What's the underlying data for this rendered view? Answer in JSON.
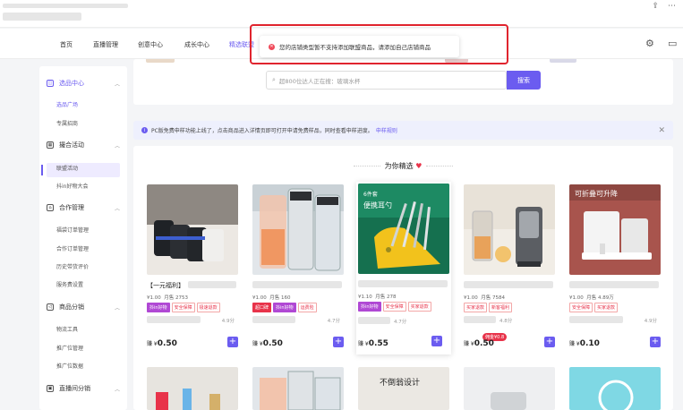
{
  "nav": {
    "items": [
      "首页",
      "直播管理",
      "创意中心",
      "成长中心",
      "精选联盟"
    ],
    "active_index": 4
  },
  "toast": {
    "message": "您的店铺类型暂不支持添加联盟商品，请添加自己店铺商品"
  },
  "sidebar": {
    "groups": [
      {
        "label": "选品中心",
        "icon": "shopping-bag-icon",
        "items": [
          "选品广场",
          "专属招商"
        ]
      },
      {
        "label": "撮合活动",
        "icon": "calendar-icon",
        "items": [
          "联盟活动",
          "抖in好物大会"
        ]
      },
      {
        "label": "合作管理",
        "icon": "handshake-icon",
        "items": [
          "福袋订单管理",
          "合作订单管理",
          "历史带货评价",
          "服务费设置"
        ]
      },
      {
        "label": "商品分销",
        "icon": "share-icon",
        "items": [
          "物流工具",
          "推广位管理",
          "推广位数据"
        ]
      },
      {
        "label": "直播间分销",
        "icon": "live-icon",
        "items": []
      }
    ],
    "active_item": "选品广场"
  },
  "search": {
    "placeholder": "超800位达人正在搜：玻璃水杯",
    "button_label": "搜索"
  },
  "notice": {
    "text": "PC版免费申样功能上线了，点击商品进入详情页即可打开申请免费样品，同时查看申样进度。",
    "link": "申样规则"
  },
  "section": {
    "title": "为你精选"
  },
  "products": [
    {
      "title": "【一元福利】",
      "price": "¥1.00",
      "sold": "月售 2753",
      "tags": [
        "抖in好物",
        "安全保障",
        "极速退款"
      ],
      "rating": "4.9分",
      "earn_prefix": "赚 ¥",
      "earn": "0.50",
      "badge": ""
    },
    {
      "title": "",
      "price": "¥1.00",
      "sold": "月售 160",
      "tags": [
        "超口碑",
        "抖in好物",
        "运费险"
      ],
      "rating": "4.7分",
      "earn_prefix": "赚 ¥",
      "earn": "0.50",
      "badge": ""
    },
    {
      "title": "",
      "price": "¥1.10",
      "sold": "月售 278",
      "tags": [
        "抖in好物",
        "安全保障",
        "买家退款"
      ],
      "rating": "4.7分",
      "earn_prefix": "赚 ¥",
      "earn": "0.55",
      "badge": ""
    },
    {
      "title": "",
      "price": "¥1.00",
      "sold": "月售 7584",
      "tags": [
        "买家退款",
        "新客福利"
      ],
      "rating": "4.8分",
      "earn_prefix": "赚 ¥",
      "earn": "0.50",
      "badge": "佣金¥0.8"
    },
    {
      "title": "",
      "price": "¥1.00",
      "sold": "月售 4.89万",
      "tags": [
        "安全保障",
        "买家退款"
      ],
      "rating": "4.9分",
      "earn_prefix": "赚 ¥",
      "earn": "0.10",
      "badge": ""
    }
  ],
  "row2_banner_text": "不倒翁设计"
}
